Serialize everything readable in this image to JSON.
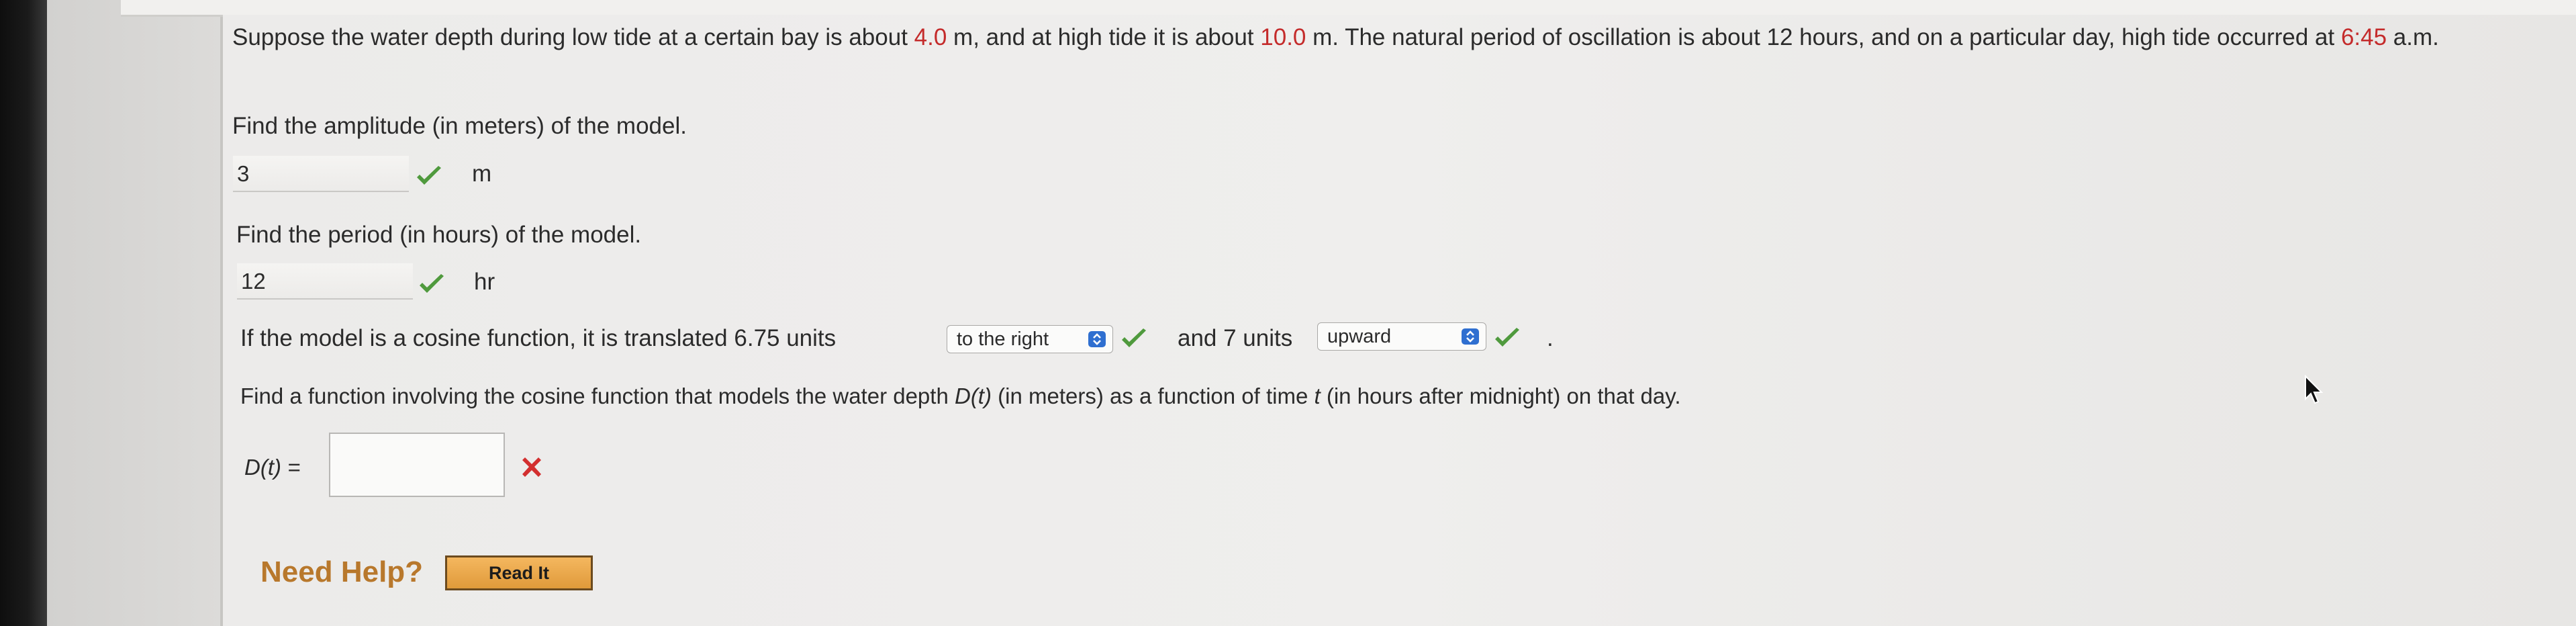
{
  "question": {
    "intro_part1": "Suppose the water depth during low tide at a certain bay is about ",
    "low_tide": "4.0",
    "intro_part2": " m, and at high tide it is about ",
    "high_tide": "10.0",
    "intro_part3": " m. The natural period of oscillation is about 12 hours, and on a particular day, high tide occurred at ",
    "high_time": "6:45",
    "intro_part4": " a.m."
  },
  "parts": {
    "amplitude": {
      "prompt": "Find the amplitude (in meters) of the model.",
      "value": "3",
      "unit": "m",
      "status": "correct"
    },
    "period": {
      "prompt": "Find the period (in hours) of the model.",
      "value": "12",
      "unit": "hr",
      "status": "correct"
    },
    "translation": {
      "text_before": "If the model is a cosine function, it is translated 6.75 units",
      "horizontal_selected": "to the right",
      "text_middle": "and 7 units",
      "vertical_selected": "upward",
      "text_end": "."
    },
    "function": {
      "prompt_before": "Find a function involving the cosine function that models the water depth ",
      "prompt_Dt": "D(t)",
      "prompt_middle": " (in meters) as a function of time ",
      "prompt_t": "t",
      "prompt_after": " (in hours after midnight) on that day.",
      "label": "D(t) =",
      "value": "",
      "status": "incorrect"
    }
  },
  "help": {
    "label": "Need Help?",
    "button": "Read It"
  },
  "colors": {
    "highlight_red": "#c42b2b",
    "check_green": "#4f9a3d",
    "x_red": "#d32f2f",
    "help_orange": "#b8782c",
    "select_blue": "#2f6fd0"
  },
  "icons": [
    "check-icon",
    "x-mark-icon",
    "chevron-updown-icon",
    "mouse-cursor-icon"
  ]
}
